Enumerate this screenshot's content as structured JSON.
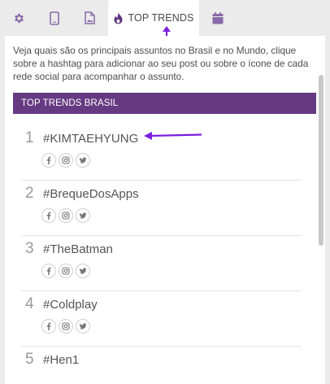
{
  "tabs": [
    {
      "name": "settings",
      "icon": "gear-icon"
    },
    {
      "name": "mobile",
      "icon": "mobile-icon"
    },
    {
      "name": "image-doc",
      "icon": "image-file-icon"
    },
    {
      "name": "top-trends",
      "icon": "flame-icon",
      "label": "TOP TRENDS",
      "active": true
    },
    {
      "name": "calendar",
      "icon": "calendar-icon"
    }
  ],
  "intro_text": "Veja quais são os principais assuntos no Brasil e no Mundo, clique sobre a hashtag para adicionar ao seu post ou sobre o ícone de cada rede social para acompanhar o assunto.",
  "section_title": "TOP TRENDS BRASIL",
  "trends": [
    {
      "rank": "1",
      "tag": "#KIMTAEHYUNG"
    },
    {
      "rank": "2",
      "tag": "#BrequeDosApps"
    },
    {
      "rank": "3",
      "tag": "#TheBatman"
    },
    {
      "rank": "4",
      "tag": "#Coldplay"
    },
    {
      "rank": "5",
      "tag": "#Hen1"
    }
  ],
  "social_icons": [
    "facebook-icon",
    "instagram-icon",
    "twitter-icon"
  ],
  "colors": {
    "accent": "#663a82",
    "icon_purple": "#7e56a0",
    "annotation": "#7b1fe0",
    "background": "#ebebeb"
  }
}
